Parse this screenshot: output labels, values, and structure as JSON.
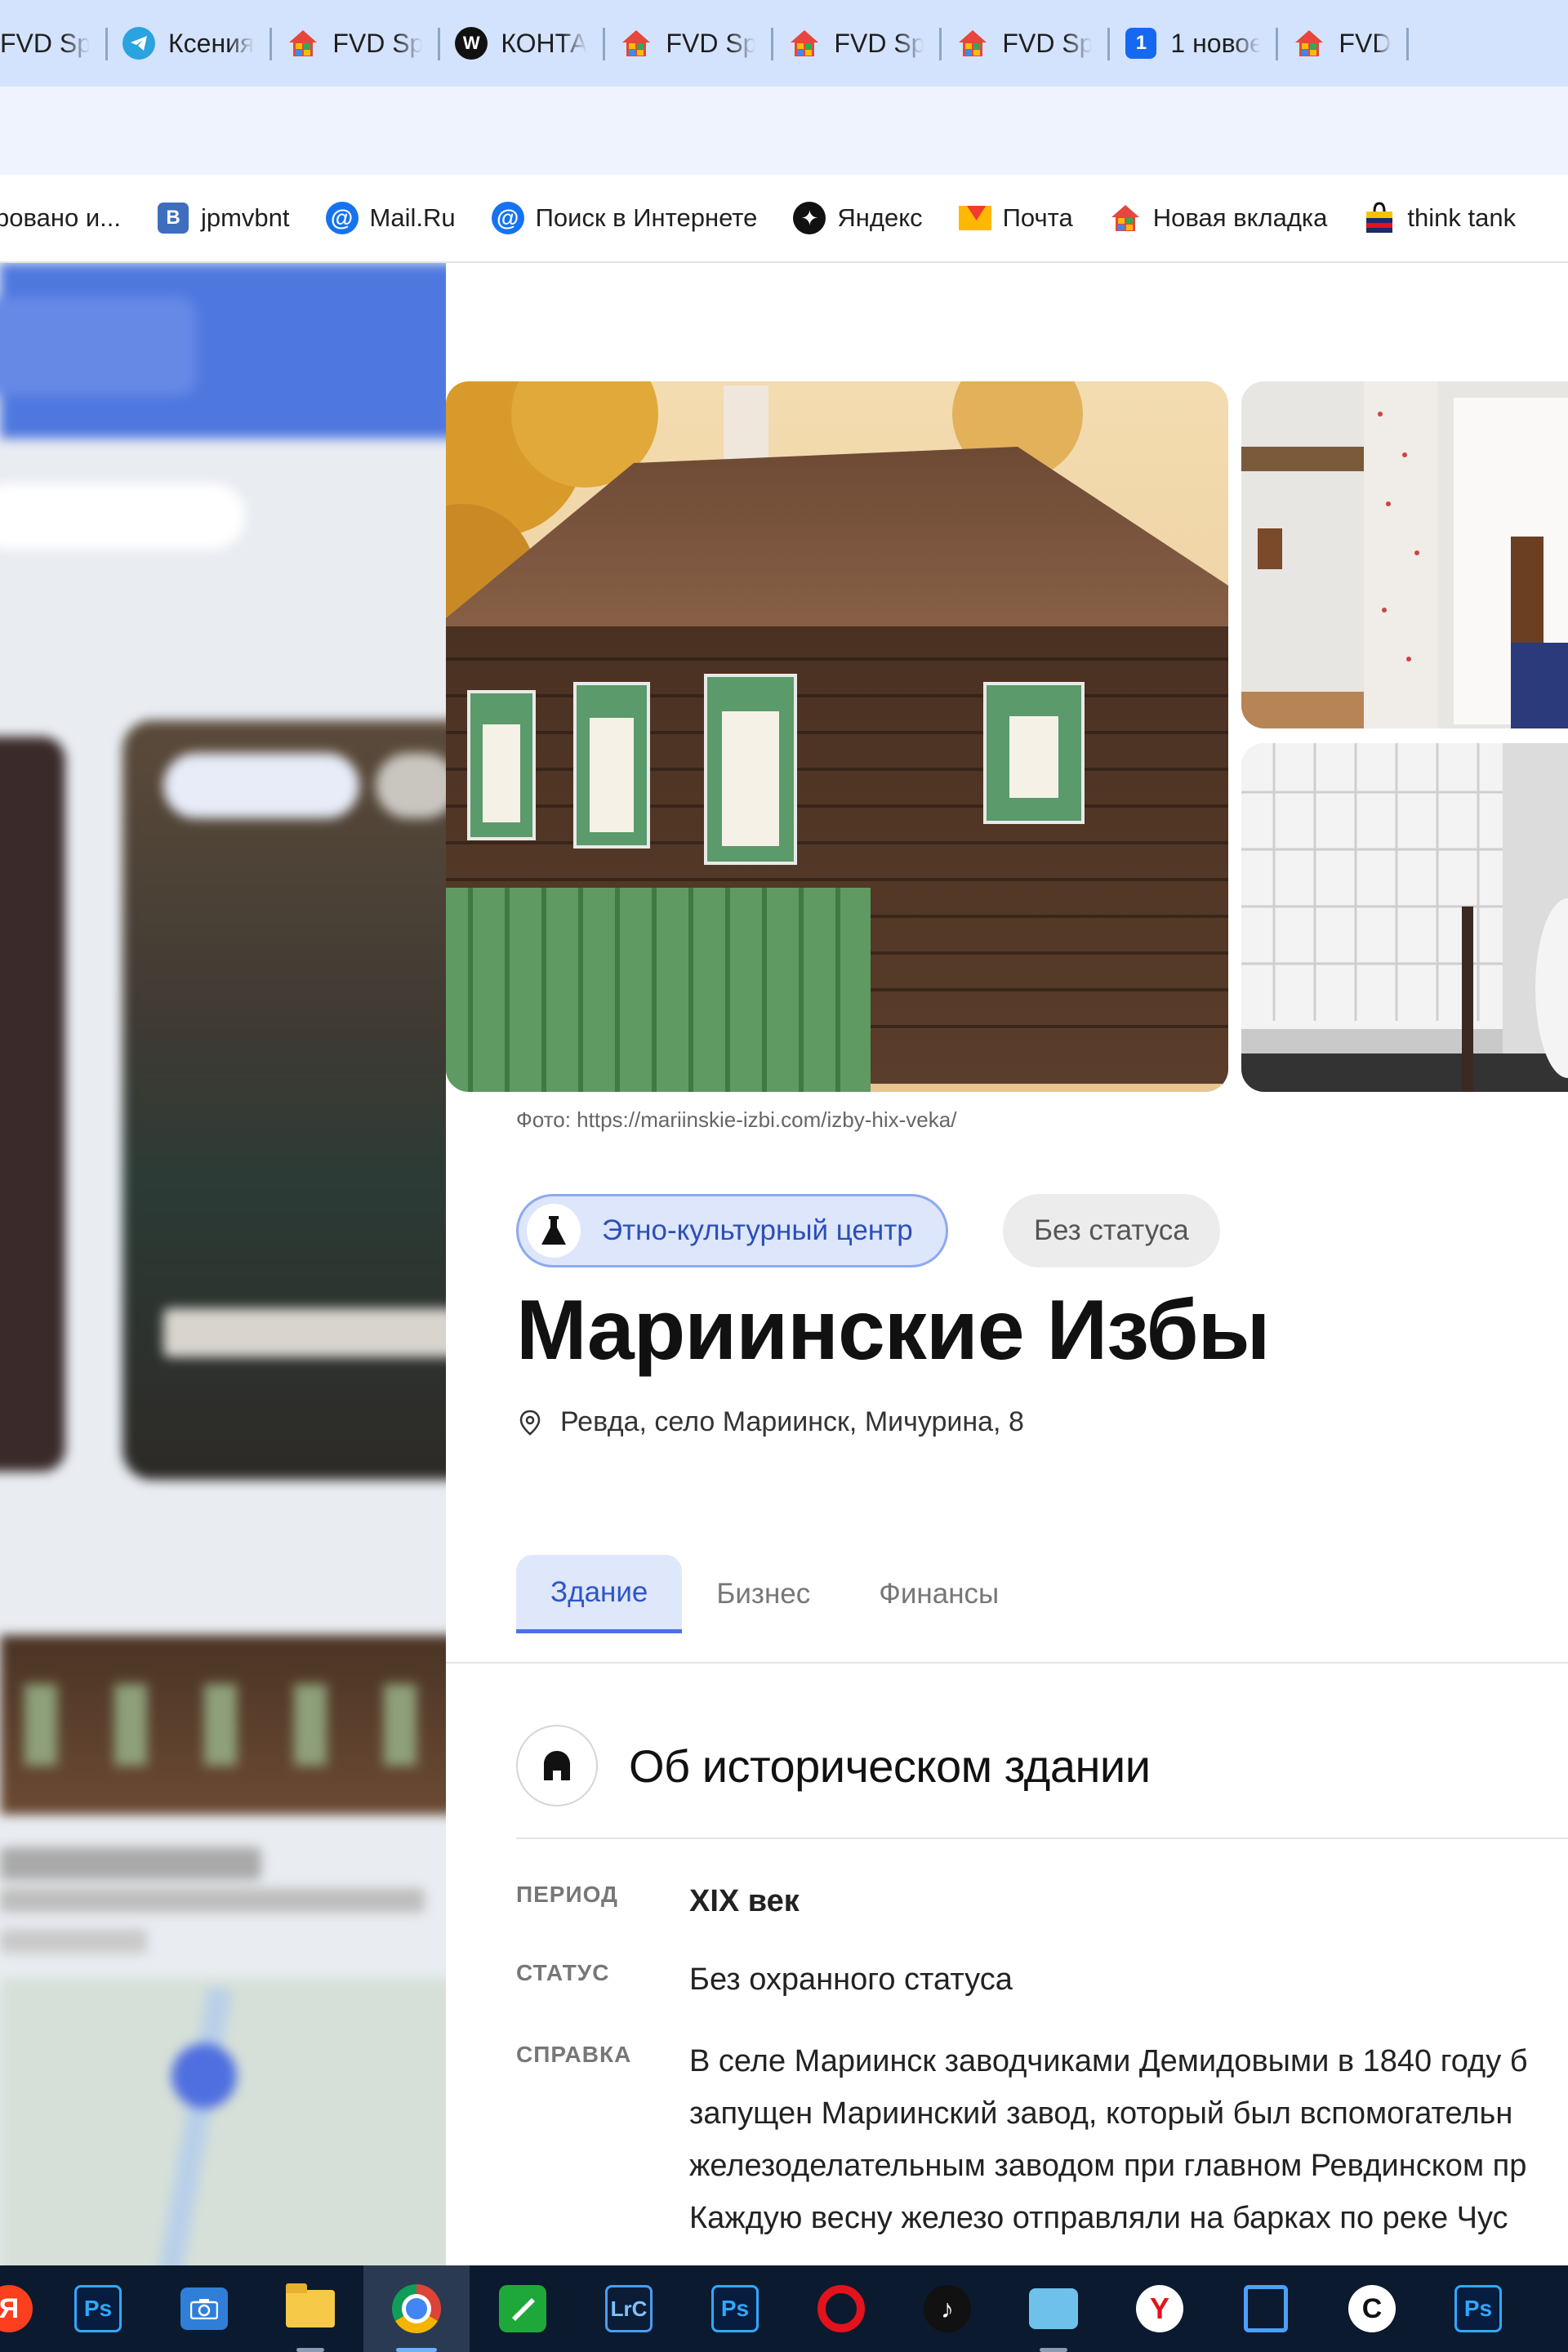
{
  "browser": {
    "tabs": [
      {
        "label": "FVD Sp",
        "icon": "fvd-house-icon"
      },
      {
        "label": "Ксения",
        "icon": "telegram-icon"
      },
      {
        "label": "FVD Sp",
        "icon": "fvd-house-icon"
      },
      {
        "label": "КОНТА",
        "icon": "w-icon"
      },
      {
        "label": "FVD Sp",
        "icon": "fvd-house-icon"
      },
      {
        "label": "FVD Sp",
        "icon": "fvd-house-icon"
      },
      {
        "label": "FVD Sp",
        "icon": "fvd-house-icon"
      },
      {
        "label": "1 новое",
        "icon": "one-badge-icon"
      },
      {
        "label": "FVD",
        "icon": "fvd-house-icon"
      }
    ],
    "bookmarks": [
      {
        "label": "ровано и...",
        "icon": ""
      },
      {
        "label": "jpmvbnt",
        "icon": "vk-icon"
      },
      {
        "label": "Mail.Ru",
        "icon": "mailru-icon"
      },
      {
        "label": "Поиск в Интернете",
        "icon": "mailru-search-icon"
      },
      {
        "label": "Яндекс",
        "icon": "yandex-icon"
      },
      {
        "label": "Почта",
        "icon": "mail-envelope-icon"
      },
      {
        "label": "Новая вкладка",
        "icon": "fvd-house-icon"
      },
      {
        "label": "think tank",
        "icon": "gift-bag-icon"
      }
    ],
    "tab_one_badge": "1",
    "w_letter": "W",
    "vk_letter": "В",
    "at_symbol": "@"
  },
  "page": {
    "photo_caption": "Фото: https://mariinskie-izbi.com/izby-hix-veka/",
    "type_chip": "Этно-культурный центр",
    "status_chip": "Без статуса",
    "title": "Мариинские Избы",
    "address": "Ревда, село Мариинск, Мичурина, 8",
    "tabs": [
      "Здание",
      "Бизнес",
      "Финансы"
    ],
    "active_tab": "Здание",
    "section_title": "Об историческом здании",
    "fields": {
      "period_label": "ПЕРИОД",
      "period_value": "XIX век",
      "status_label": "СТАТУС",
      "status_value": "Без охранного статуса",
      "info_label": "СПРАВКА",
      "info_lines": [
        "В селе Мариинск заводчиками Демидовыми в 1840 году б",
        "запущен Мариинский завод, который был вспомогательн",
        "железоделательным заводом при главном Ревдинском пр",
        "Каждую весну железо отправляли на барках по реке Чус"
      ]
    }
  },
  "taskbar": {
    "apps": [
      "yandex-browser-icon",
      "photoshop-icon",
      "camera-icon",
      "file-explorer-icon",
      "chrome-icon",
      "green-app-icon",
      "lightroom-icon",
      "photoshop-icon",
      "opera-icon",
      "tiktok-icon",
      "meet-icon",
      "yandex-y-icon",
      "shield-icon",
      "c-app-icon",
      "photoshop-icon"
    ],
    "ya_letter": "Я",
    "ps_label": "Ps",
    "lrc_label": "LrC",
    "yb_letter": "Y",
    "cc_letter": "C"
  },
  "colors": {
    "accent": "#4a72e3",
    "tab_strip": "#d3e3fd",
    "taskbar": "#0b1a2e"
  }
}
